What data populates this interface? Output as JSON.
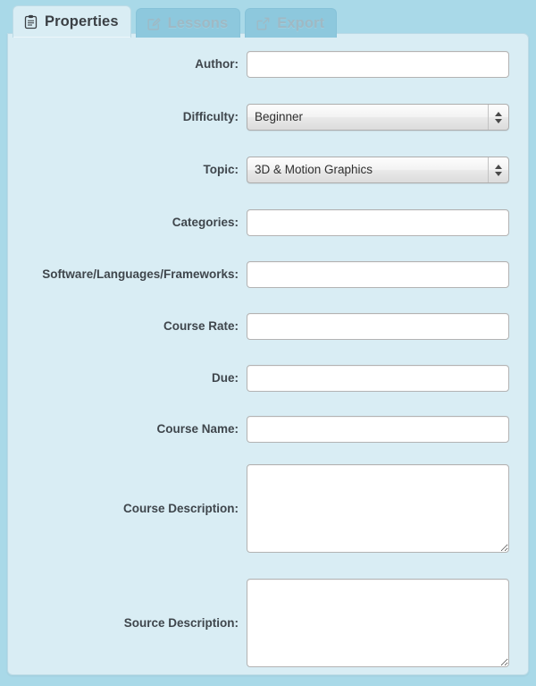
{
  "tabs": [
    {
      "label": "Properties",
      "icon": "clipboard-icon",
      "active": true
    },
    {
      "label": "Lessons",
      "icon": "edit-square-icon",
      "active": false
    },
    {
      "label": "Export",
      "icon": "external-link-icon",
      "active": false
    }
  ],
  "colors": {
    "page_background": "#a9d9e8",
    "panel_background": "#d9edf4",
    "panel_border": "#bcdbe6",
    "active_tab_background": "#d9edf4",
    "inactive_tab_background": "#8dc8dd",
    "inactive_tab_text": "#9fb9c4",
    "label_text": "#3f464c",
    "field_background": "#ffffff",
    "field_border": "#b3b3b3"
  },
  "form": {
    "fields": [
      {
        "label": "Author:",
        "type": "text",
        "value": "",
        "placeholder": "",
        "name": "author"
      },
      {
        "label": "Difficulty:",
        "type": "select",
        "value": "Beginner",
        "name": "difficulty"
      },
      {
        "label": "Topic:",
        "type": "select",
        "value": "3D & Motion Graphics",
        "name": "topic"
      },
      {
        "label": "Categories:",
        "type": "text",
        "value": "",
        "placeholder": "",
        "name": "categories"
      },
      {
        "label": "Software/Languages/Frameworks:",
        "type": "text",
        "value": "",
        "placeholder": "",
        "name": "software-languages-frameworks"
      },
      {
        "label": "Course Rate:",
        "type": "text",
        "value": "",
        "placeholder": "",
        "name": "course-rate"
      },
      {
        "label": "Due:",
        "type": "text",
        "value": "",
        "placeholder": "",
        "name": "due"
      },
      {
        "label": "Course Name:",
        "type": "text",
        "value": "",
        "placeholder": "",
        "name": "course-name"
      },
      {
        "label": "Course Description:",
        "type": "textarea",
        "value": "",
        "placeholder": "",
        "name": "course-description"
      },
      {
        "label": "Source Description:",
        "type": "textarea",
        "value": "",
        "placeholder": "",
        "name": "source-description"
      }
    ]
  }
}
